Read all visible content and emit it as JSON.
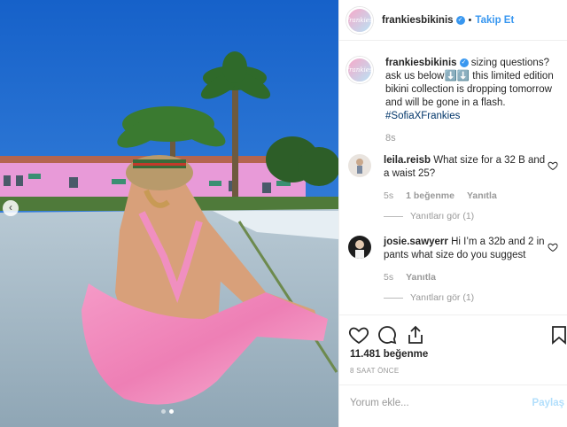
{
  "colors": {
    "link": "#3897f0",
    "hashtag": "#003569",
    "muted": "#999999",
    "post_disabled": "#b2dffc"
  },
  "post": {
    "username": "frankiesbikinis",
    "avatar_text": "frankies",
    "follow_separator": "•",
    "follow_label": "Takip Et",
    "caption": "sizing questions? ask us below⬇️⬇️ this limited edition bikini collection is dropping tomorrow and will be gone in a flash.",
    "hashtag": "#SofiaXFrankies",
    "caption_time": "8s",
    "carousel": {
      "slides": 2,
      "active_index": 1
    }
  },
  "comments": [
    {
      "username": "leila.reisb",
      "text": "What size for a 32 B and a waist 25?",
      "time": "5s",
      "likes": "1 beğenme",
      "reply": "Yanıtla",
      "view_replies": "Yanıtları gör (1)"
    },
    {
      "username": "josie.sawyerr",
      "text": "Hi I’m a 32b and 2 in pants what size do you suggest",
      "time": "5s",
      "reply": "Yanıtla",
      "view_replies": "Yanıtları gör (1)"
    }
  ],
  "actions": {
    "icons": [
      "heart-icon",
      "comment-icon",
      "share-icon",
      "bookmark-icon"
    ]
  },
  "likes_text": "11.481 beğenme",
  "time_ago": "8 SAAT ÖNCE",
  "comment_box": {
    "placeholder": "Yorum ekle...",
    "post_label": "Paylaş"
  }
}
